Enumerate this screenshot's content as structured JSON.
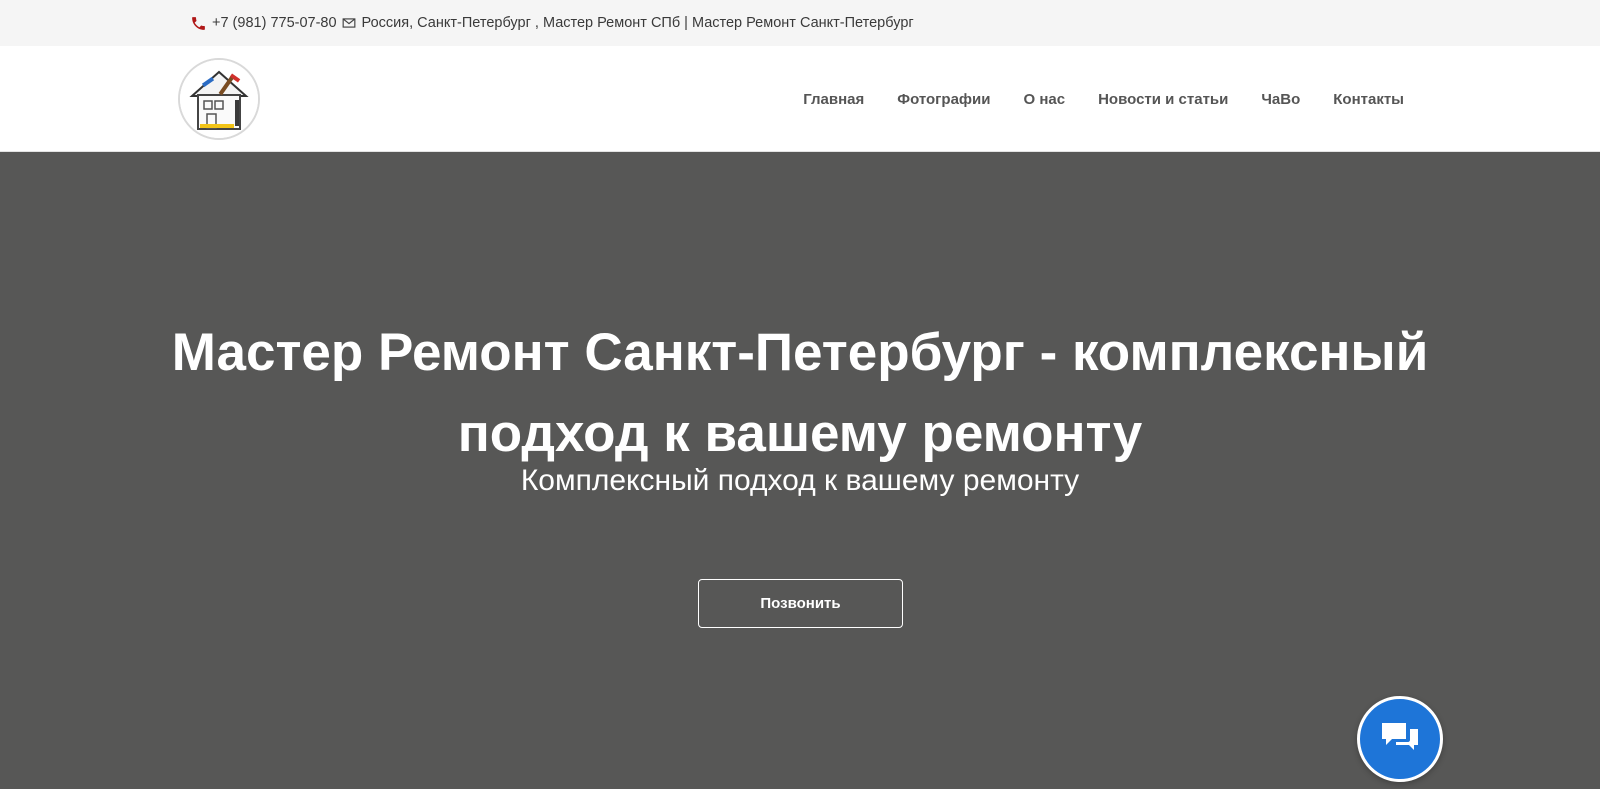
{
  "topbar": {
    "phone": "+7 (981) 775-07-80",
    "address": "Россия, Санкт-Петербург , Мастер Ремонт СПб",
    "separator": "|",
    "company": "Мастер Ремонт Санкт-Петербург",
    "phone_icon": "phone-icon",
    "mail_icon": "mail-icon"
  },
  "nav": {
    "items": [
      {
        "label": "Главная"
      },
      {
        "label": "Фотографии"
      },
      {
        "label": "О нас"
      },
      {
        "label": "Новости и статьи"
      },
      {
        "label": "ЧаВо"
      },
      {
        "label": "Контакты"
      }
    ]
  },
  "hero": {
    "title": "Мастер Ремонт Санкт-Петербург - комплексный подход к вашему ремонту",
    "subtitle": "Комплексный подход к вашему ремонту",
    "button_label": "Позвонить",
    "background_color": "#575756"
  },
  "chat": {
    "icon": "chat-bubbles-icon",
    "color": "#1e75d8"
  }
}
